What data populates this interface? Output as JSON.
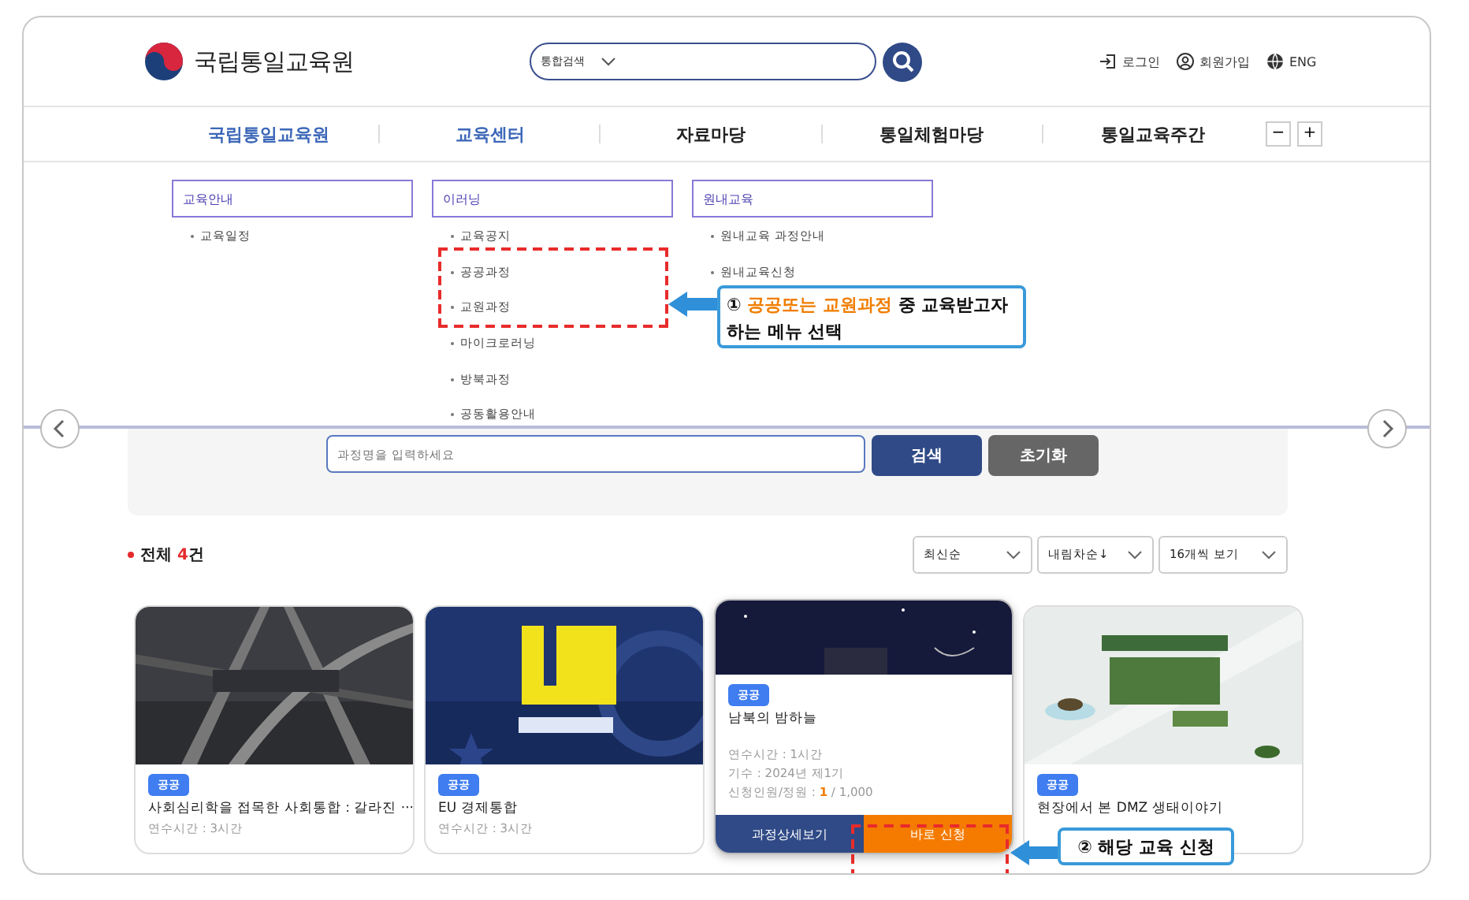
{
  "logo": {
    "text": "국립통일교육원"
  },
  "search": {
    "scope": "통합검색"
  },
  "utility": [
    {
      "kind": "login",
      "label": "로그인"
    },
    {
      "kind": "join",
      "label": "회원가입"
    },
    {
      "kind": "lang",
      "label": "ENG"
    }
  ],
  "nav": [
    {
      "label": "국립통일교육원",
      "selected": true
    },
    {
      "label": "교육센터",
      "selected": true
    },
    {
      "label": "자료마당",
      "selected": false
    },
    {
      "label": "통일체험마당",
      "selected": false
    },
    {
      "label": "통일교육주간",
      "selected": false
    }
  ],
  "zoom_buttons": [
    "−",
    "+"
  ],
  "menu": [
    {
      "title": "교육안내",
      "items": [
        "교육일정"
      ]
    },
    {
      "title": "이러닝",
      "items": [
        "교육공지",
        "공공과정",
        "교원과정",
        "마이크로러닝",
        "방북과정",
        "공동활용안내"
      ]
    },
    {
      "title": "원내교육",
      "items": [
        "원내교육 과정안내",
        "원내교육신청"
      ]
    }
  ],
  "filter": {
    "placeholder": "과정명을 입력하세요",
    "search_button": "검색",
    "reset_button": "초기화"
  },
  "results": {
    "label": "전체",
    "count": "4",
    "unit": "건"
  },
  "sorts": [
    "최신순",
    "내림차순↓",
    "16개씩 보기"
  ],
  "cards": [
    {
      "tag": "공공",
      "title": "사회심리학을 접목한 사회통합 : 갈라진 ···",
      "meta": [
        "연수시간 : 3시간"
      ],
      "hovered": false
    },
    {
      "tag": "공공",
      "title": "EU 경제통합",
      "meta": [
        "연수시간 : 3시간"
      ],
      "hovered": false
    },
    {
      "tag": "공공",
      "title": "남북의 밤하늘",
      "meta": [
        "연수시간 : 1시간",
        "기수 : 2024년 제1기"
      ],
      "applicants": {
        "label": "신청인원/정원 : ",
        "count": "1",
        "total": " / 1,000"
      },
      "buttons": [
        "과정상세보기",
        "바로 신청"
      ],
      "hovered": true
    },
    {
      "tag": "공공",
      "title": "현장에서 본 DMZ 생태이야기",
      "hovered": false
    }
  ],
  "annotations": [
    {
      "number": "①",
      "highlight": "공공또는 교원과정",
      "text": " 중 교육받고자 하는 메뉴 선택"
    },
    {
      "number": "②",
      "text": " 해당 교육 신청"
    }
  ]
}
